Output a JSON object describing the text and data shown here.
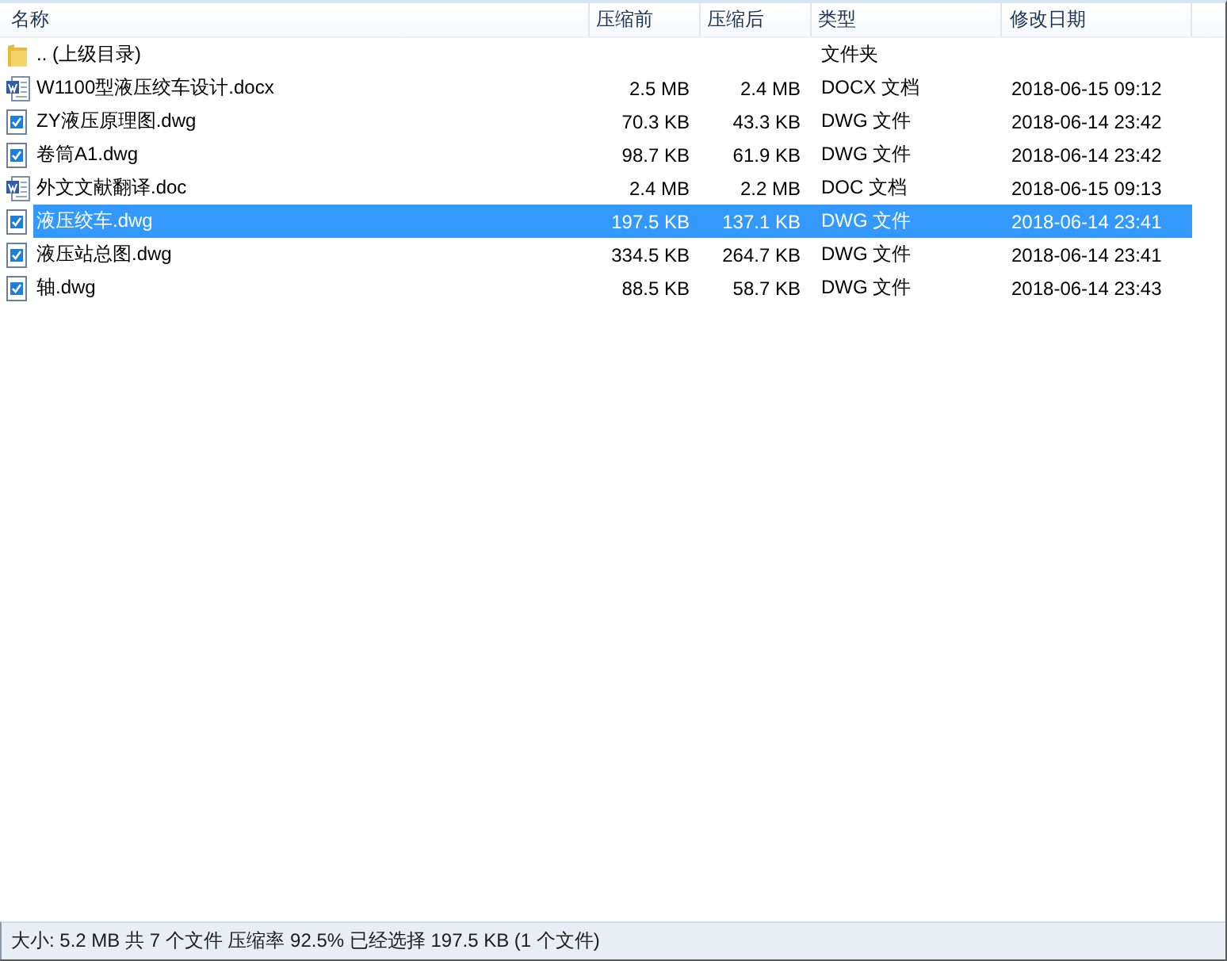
{
  "table": {
    "columns": [
      {
        "label": "名称"
      },
      {
        "label": "压缩前"
      },
      {
        "label": "压缩后"
      },
      {
        "label": "类型"
      },
      {
        "label": "修改日期"
      }
    ],
    "rows": [
      {
        "kind": "folder",
        "name": ".. (上级目录)",
        "type": "文件夹",
        "selected": false
      },
      {
        "kind": "doc",
        "name": "W1100型液压绞车设计.docx",
        "original_size": "2.5 MB",
        "compressed_size": "2.4 MB",
        "type": "DOCX 文档",
        "modified": "2018-06-15 09:12",
        "selected": false
      },
      {
        "kind": "dwg",
        "name": "ZY液压原理图.dwg",
        "original_size": "70.3 KB",
        "compressed_size": "43.3 KB",
        "type": "DWG 文件",
        "modified": "2018-06-14 23:42",
        "selected": false
      },
      {
        "kind": "dwg",
        "name": "卷筒A1.dwg",
        "original_size": "98.7 KB",
        "compressed_size": "61.9 KB",
        "type": "DWG 文件",
        "modified": "2018-06-14 23:42",
        "selected": false
      },
      {
        "kind": "doc",
        "name": "外文文献翻译.doc",
        "original_size": "2.4 MB",
        "compressed_size": "2.2 MB",
        "type": "DOC 文档",
        "modified": "2018-06-15 09:13",
        "selected": false
      },
      {
        "kind": "dwg",
        "name": "液压绞车.dwg",
        "original_size": "197.5 KB",
        "compressed_size": "137.1 KB",
        "type": "DWG 文件",
        "modified": "2018-06-14 23:41",
        "selected": true
      },
      {
        "kind": "dwg",
        "name": "液压站总图.dwg",
        "original_size": "334.5 KB",
        "compressed_size": "264.7 KB",
        "type": "DWG 文件",
        "modified": "2018-06-14 23:41",
        "selected": false
      },
      {
        "kind": "dwg",
        "name": "轴.dwg",
        "original_size": "88.5 KB",
        "compressed_size": "58.7 KB",
        "type": "DWG 文件",
        "modified": "2018-06-14 23:43",
        "selected": false
      }
    ]
  },
  "status_bar": "大小: 5.2 MB 共 7 个文件 压缩率 92.5% 已经选择 197.5 KB (1 个文件)"
}
